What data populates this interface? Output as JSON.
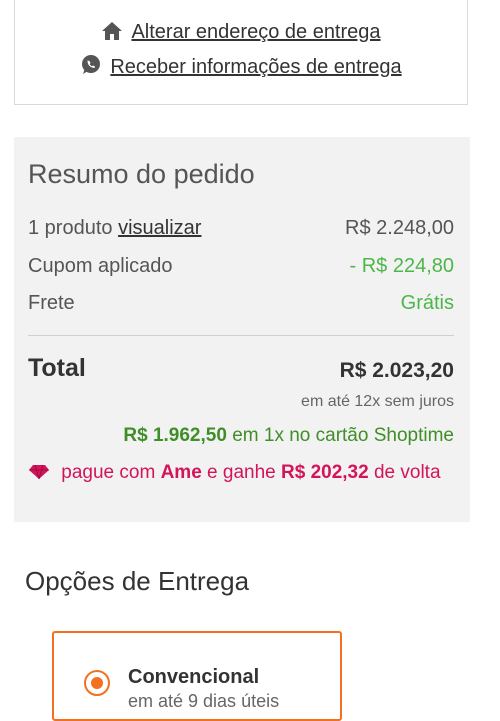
{
  "address_links": {
    "change_address": "Alterar endereço de entrega",
    "receive_info": "Receber informações de entrega"
  },
  "summary": {
    "title": "Resumo do pedido",
    "products_label": "1 produto",
    "view_link": "visualizar",
    "products_value": "R$ 2.248,00",
    "coupon_label": "Cupom aplicado",
    "coupon_value": "- R$ 224,80",
    "shipping_label": "Frete",
    "shipping_value": "Grátis",
    "total_label": "Total",
    "total_value": "R$ 2.023,20",
    "installments": "em até 12x sem juros",
    "card_price": "R$ 1.962,50",
    "card_text": "em 1x no cartão Shoptime",
    "ame_pre": "pague com",
    "ame_brand": "Ame",
    "ame_mid": "e ganhe",
    "ame_amount": "R$ 202,32",
    "ame_post": "de volta"
  },
  "delivery": {
    "title": "Opções de Entrega",
    "option_name": "Convencional",
    "option_sub": "em até 9 dias úteis"
  },
  "colors": {
    "green": "#4bb749",
    "pink": "#d4145a",
    "orange": "#f37021"
  },
  "icons": [
    "home-icon",
    "whatsapp-icon",
    "diamond-icon"
  ]
}
